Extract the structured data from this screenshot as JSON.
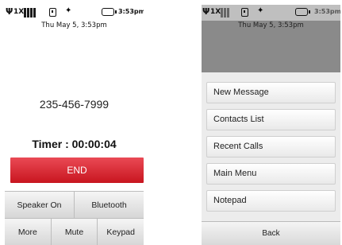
{
  "call_screen": {
    "status": {
      "carrier": "1X",
      "time": "3:53pm"
    },
    "datetime": "Thu  May 5,  3:53pm",
    "phone_number": "235-456-7999",
    "timer": "Timer : 00:00:04",
    "end_label": "END",
    "row1": [
      "Speaker On",
      "Bluetooth"
    ],
    "row2": [
      "More",
      "Mute",
      "Keypad"
    ]
  },
  "menu_screen": {
    "status": {
      "carrier": "1X",
      "time": "3:53pm"
    },
    "datetime": "Thu  May 5,  3:53pm",
    "items": [
      "New Message",
      "Contacts List",
      "Recent Calls",
      "Main Menu",
      "Notepad"
    ],
    "back_label": "Back"
  }
}
